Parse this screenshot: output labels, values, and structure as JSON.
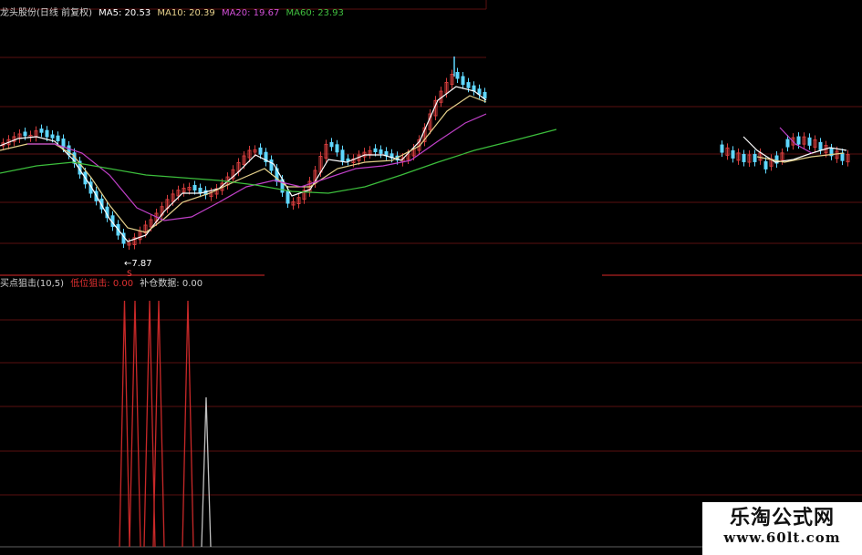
{
  "top_legend": {
    "name": "龙头股份(日线 前复权)",
    "ma5": "MA5: 20.53",
    "ma10": "MA10: 20.39",
    "ma20": "MA20: 19.67",
    "ma60": "MA60: 23.93"
  },
  "bottom_legend": {
    "indicator": "买点狙击(10,5)",
    "low_signal": "低位狙击: 0.00",
    "replenish": "补仓数据: 0.00"
  },
  "low_price_label": "←7.87",
  "signal_letter": "S",
  "watermark": {
    "title": "乐淘公式网",
    "url": "www.60lt.com"
  },
  "colors": {
    "background": "#000000",
    "grid": "#5a0f0f",
    "up": "#d23c3c",
    "down": "#5fd7ff",
    "ma5": "#ffffff",
    "ma10": "#e6d28c",
    "ma20": "#c040c8",
    "ma60": "#3cbe3c",
    "signal_red": "#c82828",
    "signal_gray": "#c0c0c0"
  },
  "chart_data": {
    "type": "candlestick",
    "title": "龙头股份(日线 前复权)",
    "series": [
      {
        "name": "MA5",
        "last": 20.53
      },
      {
        "name": "MA10",
        "last": 20.39
      },
      {
        "name": "MA20",
        "last": 19.67
      },
      {
        "name": "MA60",
        "last": 23.93
      }
    ],
    "annotations": [
      {
        "text": "←7.87",
        "meaning": "period low"
      }
    ],
    "indicator_panel": {
      "name": "买点狙击(10,5)",
      "series": [
        {
          "name": "低位狙击",
          "last": 0.0,
          "spikes": 5
        },
        {
          "name": "补仓数据",
          "last": 0.0,
          "spikes": 1
        }
      ]
    },
    "grid": true
  }
}
